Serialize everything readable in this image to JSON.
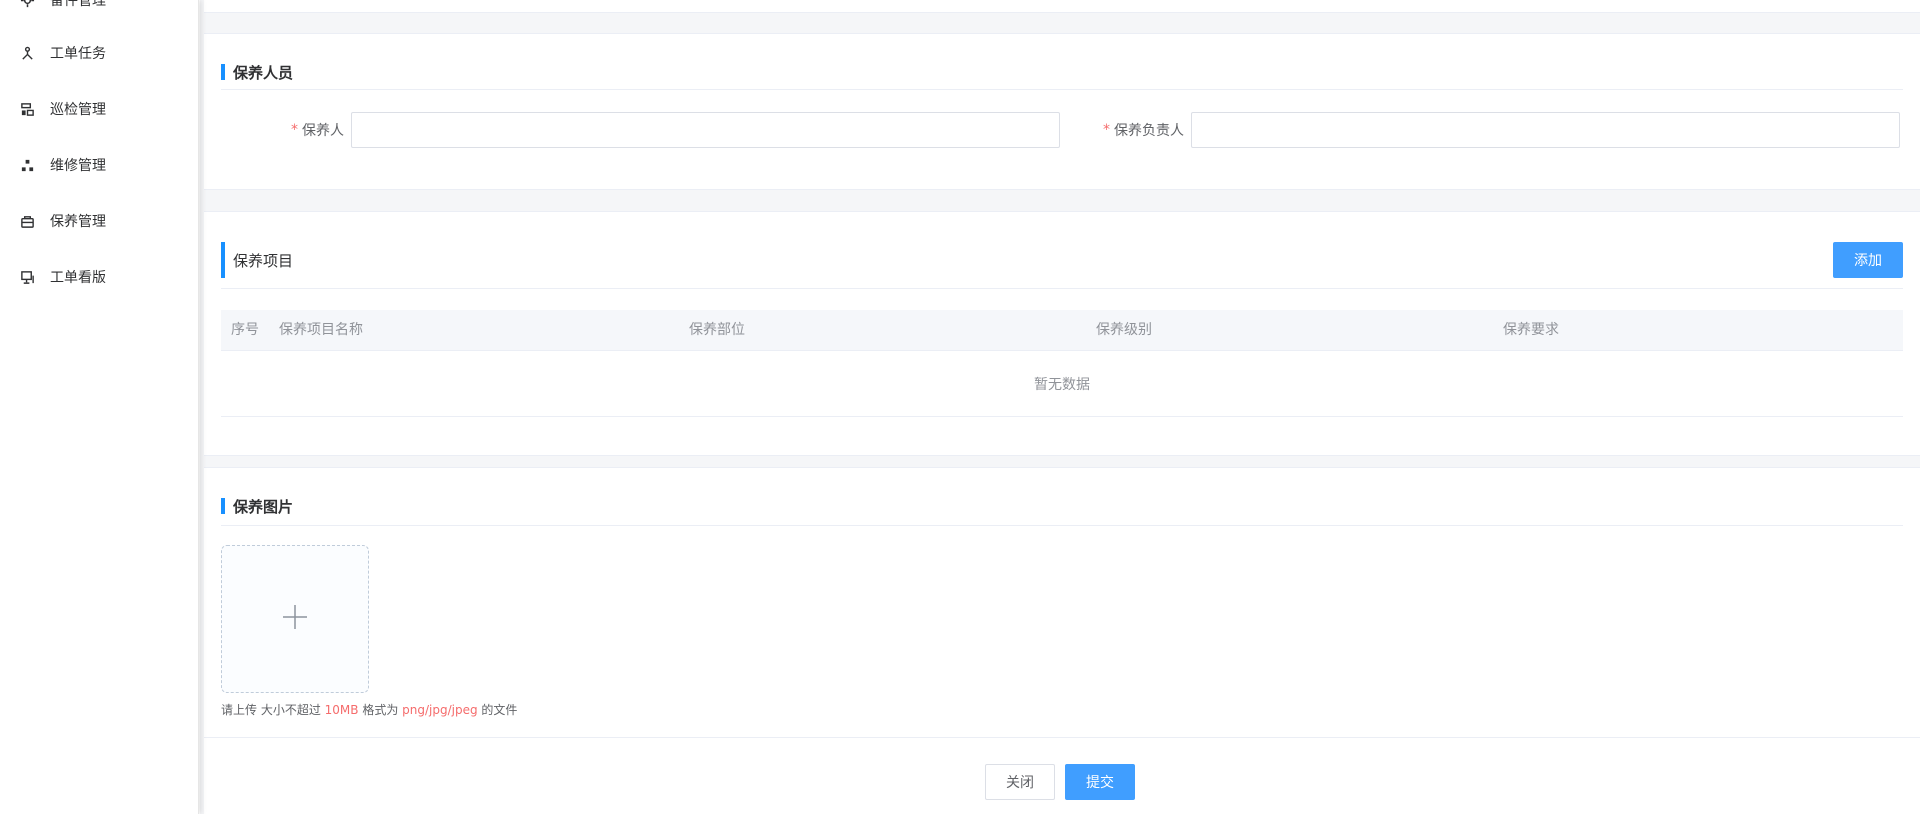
{
  "sidebar": {
    "items": [
      {
        "label": "备件管理",
        "icon": "gear-icon"
      },
      {
        "label": "工单任务",
        "icon": "person-icon"
      },
      {
        "label": "巡检管理",
        "icon": "inspection-icon"
      },
      {
        "label": "维修管理",
        "icon": "nodes-icon"
      },
      {
        "label": "保养管理",
        "icon": "toolbox-icon"
      },
      {
        "label": "工单看版",
        "icon": "monitor-icon"
      }
    ]
  },
  "personnel": {
    "title": "保养人员",
    "required_mark": "*",
    "maintainer_label": "保养人",
    "maintainer_value": "",
    "manager_label": "保养负责人",
    "manager_value": ""
  },
  "items": {
    "title": "保养项目",
    "add_label": "添加",
    "columns": [
      "序号",
      "保养项目名称",
      "保养部位",
      "保养级别",
      "保养要求"
    ],
    "empty_text": "暂无数据"
  },
  "photos": {
    "title": "保养图片",
    "plus_icon": "plus-icon",
    "tip_prefix": "请上传 大小不超过 ",
    "tip_size": "10MB",
    "tip_mid": " 格式为 ",
    "tip_formats": "png/jpg/jpeg",
    "tip_suffix": " 的文件"
  },
  "footer": {
    "close_label": "关闭",
    "submit_label": "提交"
  },
  "colors": {
    "accent": "#409eff",
    "section_bar": "#1890ff",
    "required": "#f56c6c"
  }
}
